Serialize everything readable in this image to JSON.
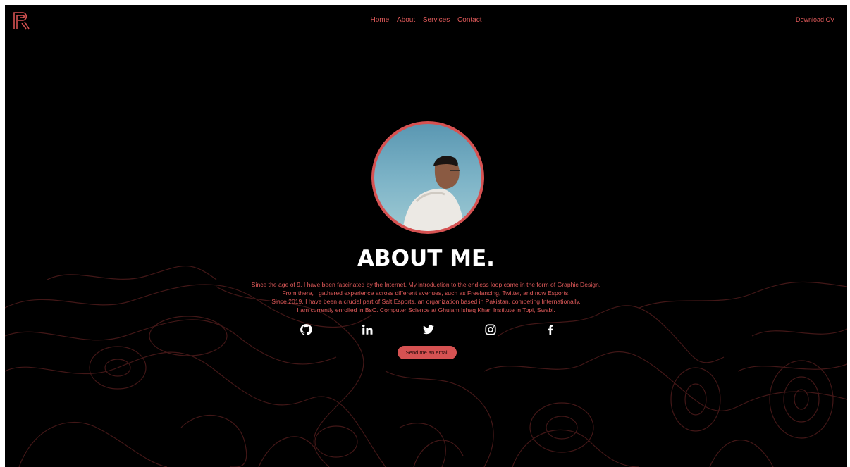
{
  "brand": {
    "logo_icon": "letter-p-logo-icon",
    "accent_color": "#d65252"
  },
  "nav": {
    "items": [
      {
        "label": "Home"
      },
      {
        "label": "About"
      },
      {
        "label": "Services"
      },
      {
        "label": "Contact"
      }
    ],
    "download_cv": "Download CV"
  },
  "about": {
    "avatar_icon": "profile-photo",
    "title": "ABOUT ME.",
    "bio_lines": [
      "Since the age of 9, I have been fascinated by the Internet. My introduction to the endless loop came in the form of Graphic Design.",
      "From there, I gathered experience across different avenues, such as Freelancing, Twitter, and now Esports.",
      "Since 2019, I have been a crucial part of Salt Esports, an organization based in Pakistan, competing Internationally.",
      "I am currently enrolled in BsC. Computer Science at Ghulam Ishaq Khan Institute in Topi, Swabi."
    ]
  },
  "socials": [
    "github-icon",
    "linkedin-icon",
    "twitter-icon",
    "instagram-icon",
    "facebook-icon"
  ],
  "cta": {
    "email_label": "Send me an email"
  },
  "colors": {
    "background": "#000000",
    "text_accent": "#e05a5a",
    "title": "#ffffff",
    "topo_lines": "#3a1616"
  }
}
